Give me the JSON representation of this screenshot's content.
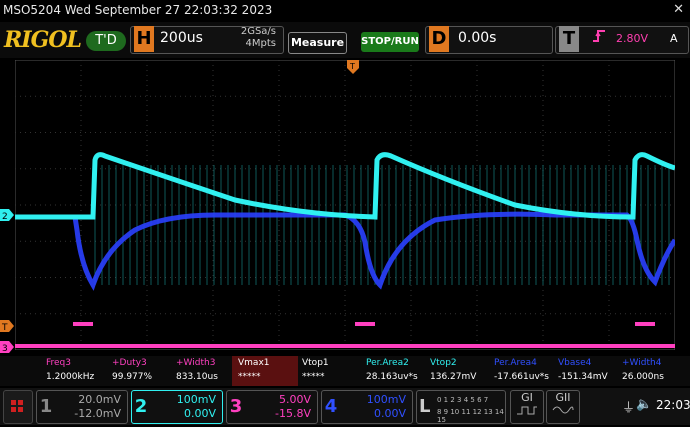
{
  "titlebar": {
    "text": "MSO5204  Wed September 27 22:03:32 2023",
    "close_glyph": "✕"
  },
  "toolbar": {
    "logo": "RIGOL",
    "trigger_state": "T'D",
    "horizontal": {
      "letter": "H",
      "scale": "200us",
      "sample_rate": "2GSa/s",
      "memory_depth": "4Mpts"
    },
    "measure_label": "Measure",
    "stoprun_label": "STOP/RUN",
    "delay": {
      "letter": "D",
      "offset": "0.00s"
    },
    "trigger": {
      "letter": "T",
      "edge_icon": "rising-edge-icon",
      "level": "2.80V",
      "mode": "A"
    }
  },
  "markers": {
    "ch2_label": "2",
    "trig_level_label": "T",
    "ch3_label": "3",
    "trig_pos_label": "T"
  },
  "measurements": [
    {
      "label": "Freq3",
      "value": "1.2000kHz",
      "color": "#ff40c0"
    },
    {
      "label": "+Duty3",
      "value": "99.977%",
      "color": "#ff40c0"
    },
    {
      "label": "+Width3",
      "value": "833.10us",
      "color": "#ff40c0"
    },
    {
      "label": "Vmax1",
      "value": "*****",
      "color": "#ffffff"
    },
    {
      "label": "Vtop1",
      "value": "*****",
      "color": "#ffffff"
    },
    {
      "label": "Per.Area2",
      "value": "28.163uv*s",
      "color": "#30f0f0"
    },
    {
      "label": "Vtop2",
      "value": "136.27mV",
      "color": "#30f0f0"
    },
    {
      "label": "Per.Area4",
      "value": "-17.661uv*s",
      "color": "#3050ff"
    },
    {
      "label": "Vbase4",
      "value": "-151.34mV",
      "color": "#3050ff"
    },
    {
      "label": "+Width4",
      "value": "26.000ns",
      "color": "#3050ff"
    }
  ],
  "channels": [
    {
      "num": "1",
      "scale": "20.0mV",
      "offset": "-12.0mV",
      "color": "#ffff40"
    },
    {
      "num": "2",
      "scale": "100mV",
      "offset": "0.00V",
      "color": "#30f0f0"
    },
    {
      "num": "3",
      "scale": "5.00V",
      "offset": "-15.8V",
      "color": "#ff40c0"
    },
    {
      "num": "4",
      "scale": "100mV",
      "offset": "0.00V",
      "color": "#3050ff"
    }
  ],
  "logic": {
    "letter": "L",
    "row1": "0 1 2 3 4 5 6 7",
    "row2": "8 9 10 11 12 13 14 15"
  },
  "generators": {
    "g1": "GI",
    "g2": "GII"
  },
  "status": {
    "usb_icon": "usb-icon",
    "volume_icon": "volume-icon",
    "time": "22:03"
  },
  "colors": {
    "ch2": "#30f0f0",
    "ch3": "#ff40c0",
    "ch4": "#3050ff",
    "trigger": "#e07820"
  }
}
